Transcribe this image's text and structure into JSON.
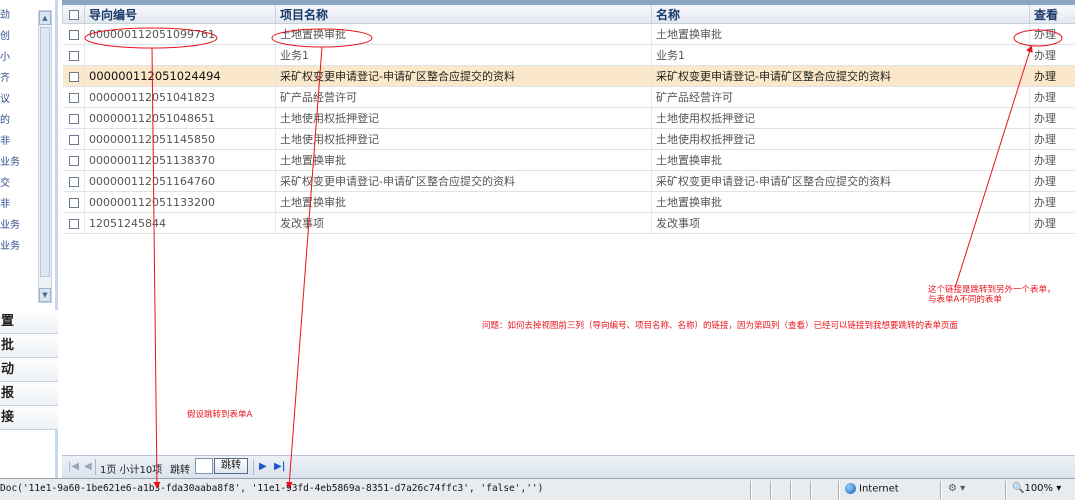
{
  "sidebar": {
    "links": [
      "劲",
      "创",
      "小",
      "齐",
      "议",
      "的",
      "非",
      "业务",
      "交",
      "非",
      "业务",
      "业务"
    ],
    "groups": [
      "置",
      "批",
      "动",
      "报",
      "接"
    ]
  },
  "table": {
    "headers": [
      "导向编号",
      "项目名称",
      "名称",
      "查看"
    ],
    "rows": [
      {
        "code": "000000112051099761",
        "project": "土地置换审批",
        "name": "土地置换审批",
        "action": "办理"
      },
      {
        "code": "",
        "project": "业务1",
        "name": "业务1",
        "action": "办理"
      },
      {
        "code": "000000112051024494",
        "project": "采矿权变更申请登记-申请矿区整合应提交的资料",
        "name": "采矿权变更申请登记-申请矿区整合应提交的资料",
        "action": "办理"
      },
      {
        "code": "000000112051041823",
        "project": "矿产品经营许可",
        "name": "矿产品经营许可",
        "action": "办理"
      },
      {
        "code": "000000112051048651",
        "project": "土地使用权抵押登记",
        "name": "土地使用权抵押登记",
        "action": "办理"
      },
      {
        "code": "000000112051145850",
        "project": "土地使用权抵押登记",
        "name": "土地使用权抵押登记",
        "action": "办理"
      },
      {
        "code": "000000112051138370",
        "project": "土地置换审批",
        "name": "土地置换审批",
        "action": "办理"
      },
      {
        "code": "000000112051164760",
        "project": "采矿权变更申请登记-申请矿区整合应提交的资料",
        "name": "采矿权变更申请登记-申请矿区整合应提交的资料",
        "action": "办理"
      },
      {
        "code": "000000112051133200",
        "project": "土地置换审批",
        "name": "土地置换审批",
        "action": "办理"
      },
      {
        "code": "12051245844",
        "project": "发改事项",
        "name": "发改事项",
        "action": "办理"
      }
    ],
    "highlighted_row": 2
  },
  "pager": {
    "first": "|◀",
    "prev": "◀",
    "info": "1页 小计10项",
    "jump_label": "跳转",
    "jump_button": "跳转",
    "next": "▶",
    "last": "▶|"
  },
  "annotations": {
    "link_note_line1": "这个链接是跳转到另外一个表单，",
    "link_note_line2": "与表单A不同的表单",
    "question": "问题：如何去掉视图前三列（导向编号、项目名称、名称）的链接，因为第四列（查看）已经可以链接到我想要跳转的表单页面",
    "assume": "假设跳转到表单A",
    "color": "#e8141c"
  },
  "statusbar": {
    "script_text": "Doc('11e1-9a60-1be621e6-a1b3-fda30aaba8f8', '11e1-93fd-4eb5869a-8351-d7a26c74ffc3', 'false','')",
    "zone": "Internet",
    "protected": "⚙ ▾",
    "zoom": "🔍100%  ▾"
  }
}
